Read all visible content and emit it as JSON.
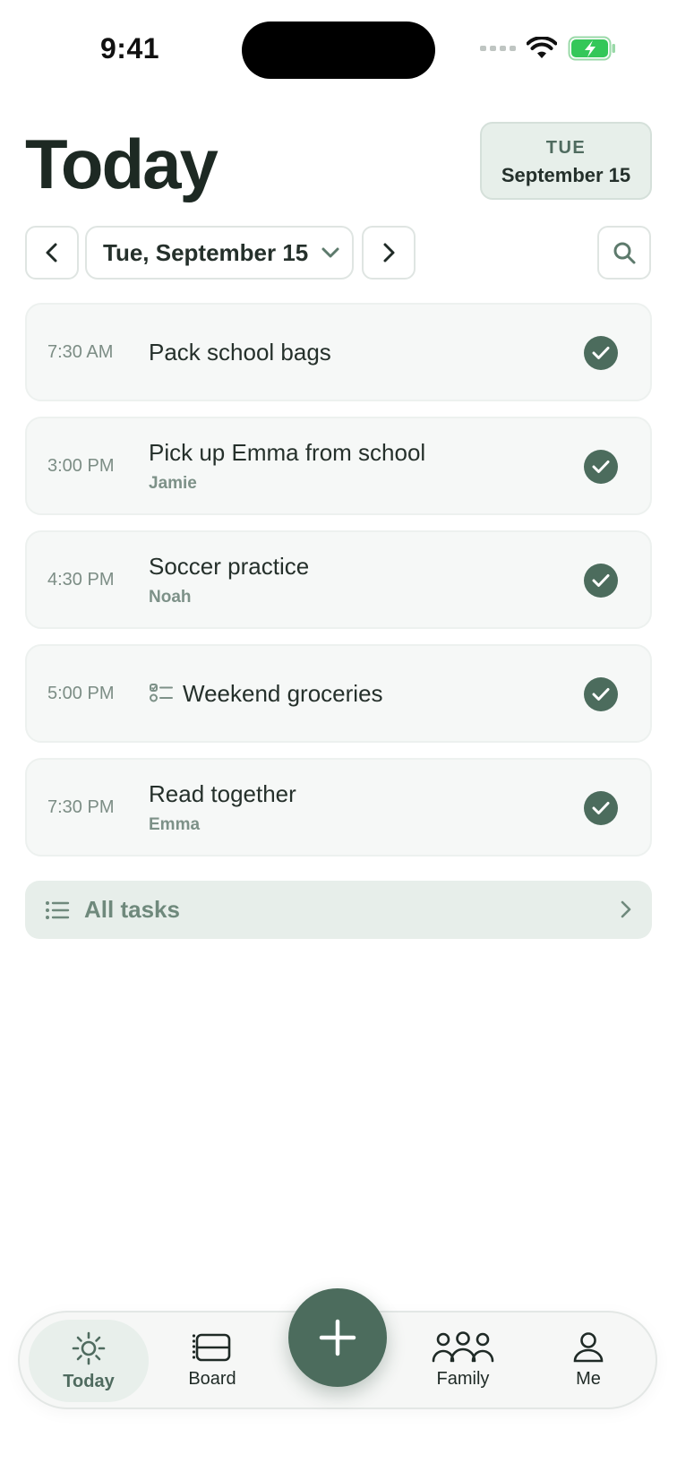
{
  "status_bar": {
    "time": "9:41"
  },
  "header": {
    "title": "Today",
    "badge_weekday": "TUE",
    "badge_date": "September 15"
  },
  "date_nav": {
    "selected_date": "Tue, September 15"
  },
  "tasks": [
    {
      "time": "7:30 AM",
      "title": "Pack school bags",
      "assignee": "",
      "done": true
    },
    {
      "time": "3:00 PM",
      "title": "Pick up Emma from school",
      "assignee": "Jamie",
      "done": true
    },
    {
      "time": "4:30 PM",
      "title": "Soccer practice",
      "assignee": "Noah",
      "done": true
    },
    {
      "time": "5:00 PM",
      "title": "Weekend groceries",
      "assignee": "",
      "done": true,
      "icon": "checklist-icon"
    },
    {
      "time": "7:30 PM",
      "title": "Read together",
      "assignee": "Emma",
      "done": true
    }
  ],
  "all_tasks": {
    "label": "All tasks"
  },
  "tabbar": {
    "tabs": [
      {
        "label": "Today",
        "icon": "sun-icon",
        "active": true
      },
      {
        "label": "Board",
        "icon": "board-icon",
        "active": false
      },
      {
        "label": "Family",
        "icon": "family-icon",
        "active": false
      },
      {
        "label": "Me",
        "icon": "person-icon",
        "active": false
      }
    ]
  },
  "colors": {
    "accent": "#4c6c5d",
    "accent_light": "#e7efea",
    "battery": "#34c759"
  }
}
